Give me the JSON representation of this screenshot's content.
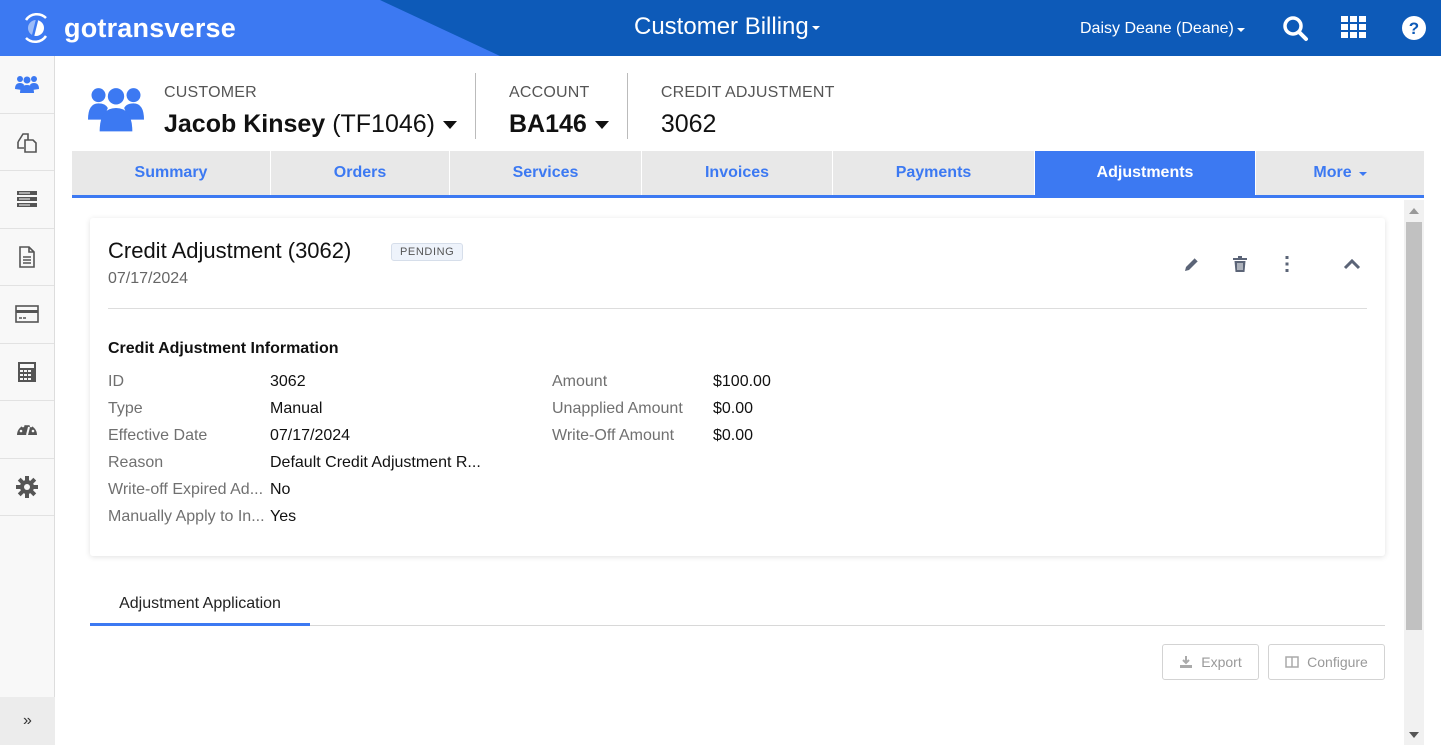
{
  "topbar": {
    "brand": "gotransverse",
    "app_name": "Customer Billing",
    "user_name": "Daisy Deane (Deane)",
    "icons": [
      "search-icon",
      "apps-grid-icon",
      "help-icon"
    ],
    "colors": {
      "primary": "#3c79f2",
      "dark": "#0d5ab8"
    }
  },
  "sidebar": {
    "items": [
      {
        "name": "customers",
        "icon": "users-icon",
        "active": true
      },
      {
        "name": "orders",
        "icon": "copy-icon"
      },
      {
        "name": "services",
        "icon": "server-icon"
      },
      {
        "name": "invoices",
        "icon": "document-icon"
      },
      {
        "name": "payments",
        "icon": "credit-card-icon"
      },
      {
        "name": "calculator",
        "icon": "calculator-icon"
      },
      {
        "name": "dashboard",
        "icon": "gauge-icon"
      },
      {
        "name": "settings",
        "icon": "gear-icon"
      }
    ],
    "expand_label": "»"
  },
  "context": {
    "customer_label": "CUSTOMER",
    "customer_name": "Jacob Kinsey",
    "customer_id": "(TF1046)",
    "account_label": "ACCOUNT",
    "account_value": "BA146",
    "adjustment_label": "CREDIT ADJUSTMENT",
    "adjustment_value": "3062"
  },
  "tabs": [
    {
      "label": "Summary"
    },
    {
      "label": "Orders"
    },
    {
      "label": "Services"
    },
    {
      "label": "Invoices"
    },
    {
      "label": "Payments"
    },
    {
      "label": "Adjustments",
      "active": true
    },
    {
      "label": "More"
    }
  ],
  "card": {
    "title": "Credit Adjustment (3062)",
    "status": "PENDING",
    "date": "07/17/2024",
    "section_title": "Credit Adjustment Information",
    "left_fields": [
      {
        "label": "ID",
        "value": "3062"
      },
      {
        "label": "Type",
        "value": "Manual"
      },
      {
        "label": "Effective Date",
        "value": "07/17/2024"
      },
      {
        "label": "Reason",
        "value": "Default Credit Adjustment R..."
      },
      {
        "label": "Write-off Expired Ad...",
        "value": "No"
      },
      {
        "label": "Manually Apply to In...",
        "value": "Yes"
      }
    ],
    "right_fields": [
      {
        "label": "Amount",
        "value": "$100.00"
      },
      {
        "label": "Unapplied Amount",
        "value": "$0.00"
      },
      {
        "label": "Write-Off Amount",
        "value": "$0.00"
      }
    ]
  },
  "subtabs": [
    {
      "label": "Adjustment Application",
      "active": true
    }
  ],
  "toolbar": {
    "export_label": "Export",
    "configure_label": "Configure"
  }
}
